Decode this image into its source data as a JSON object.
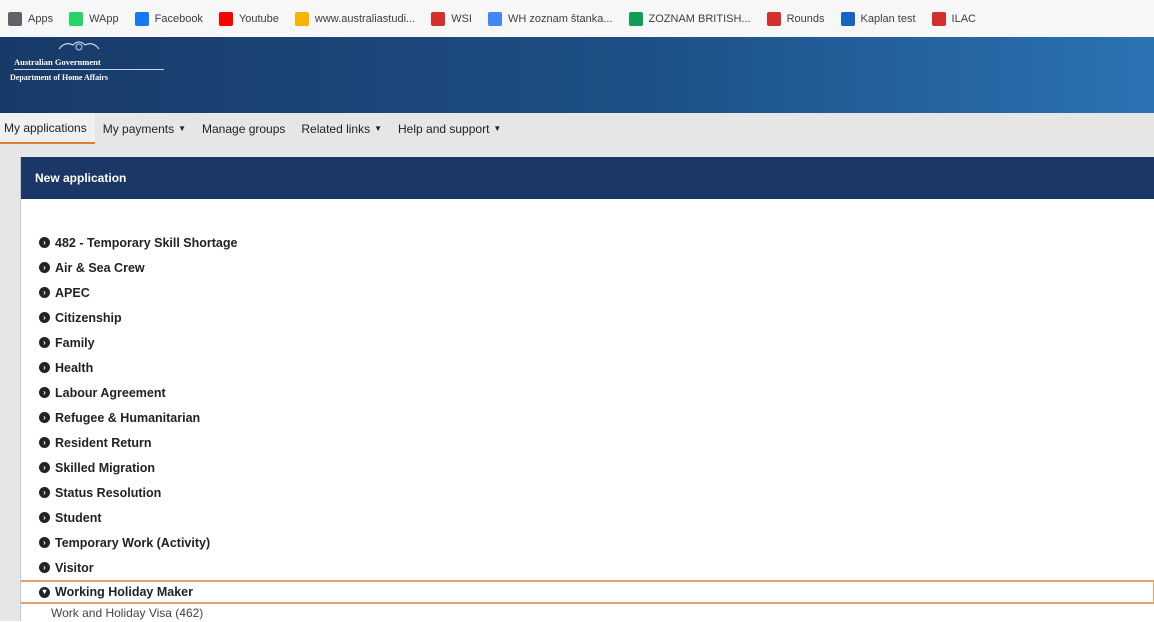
{
  "bookmarks": [
    {
      "label": "Apps",
      "icon": "apps-grid-icon",
      "color": "#5f6368"
    },
    {
      "label": "WApp",
      "icon": "whatsapp-icon",
      "color": "#25d366"
    },
    {
      "label": "Facebook",
      "icon": "facebook-icon",
      "color": "#1877f2"
    },
    {
      "label": "Youtube",
      "icon": "youtube-icon",
      "color": "#ff0000"
    },
    {
      "label": "www.australiastudi...",
      "icon": "site-icon",
      "color": "#f4b400"
    },
    {
      "label": "WSI",
      "icon": "maple-leaf-icon",
      "color": "#d32f2f"
    },
    {
      "label": "WH zoznam štanka...",
      "icon": "google-icon",
      "color": "#4285f4"
    },
    {
      "label": "ZOZNAM BRITISH...",
      "icon": "sheets-icon",
      "color": "#0f9d58"
    },
    {
      "label": "Rounds",
      "icon": "maple-leaf-icon",
      "color": "#d32f2f"
    },
    {
      "label": "Kaplan test",
      "icon": "kaplan-icon",
      "color": "#1565c0"
    },
    {
      "label": "ILAC",
      "icon": "maple-leaf-icon",
      "color": "#d32f2f"
    }
  ],
  "header": {
    "government": "Australian Government",
    "department": "Department of Home Affairs"
  },
  "nav": [
    {
      "label": "My applications",
      "dropdown": false,
      "active": true
    },
    {
      "label": "My payments",
      "dropdown": true,
      "active": false
    },
    {
      "label": "Manage groups",
      "dropdown": false,
      "active": false
    },
    {
      "label": "Related links",
      "dropdown": true,
      "active": false
    },
    {
      "label": "Help and support",
      "dropdown": true,
      "active": false
    }
  ],
  "panel": {
    "title": "New application"
  },
  "categories": [
    {
      "label": "482 - Temporary Skill Shortage",
      "expanded": false
    },
    {
      "label": "Air & Sea Crew",
      "expanded": false
    },
    {
      "label": "APEC",
      "expanded": false
    },
    {
      "label": "Citizenship",
      "expanded": false
    },
    {
      "label": "Family",
      "expanded": false
    },
    {
      "label": "Health",
      "expanded": false
    },
    {
      "label": "Labour Agreement",
      "expanded": false
    },
    {
      "label": "Refugee & Humanitarian",
      "expanded": false
    },
    {
      "label": "Resident Return",
      "expanded": false
    },
    {
      "label": "Skilled Migration",
      "expanded": false
    },
    {
      "label": "Status Resolution",
      "expanded": false
    },
    {
      "label": "Student",
      "expanded": false
    },
    {
      "label": "Temporary Work (Activity)",
      "expanded": false
    },
    {
      "label": "Visitor",
      "expanded": false
    },
    {
      "label": "Working Holiday Maker",
      "expanded": true,
      "children": [
        "Work and Holiday Visa (462)"
      ]
    }
  ],
  "colors": {
    "banner": "#1b3766",
    "panel_header": "#1b3766",
    "nav_active_underline": "#e07a2d",
    "selected_outline": "#e6a06f"
  }
}
